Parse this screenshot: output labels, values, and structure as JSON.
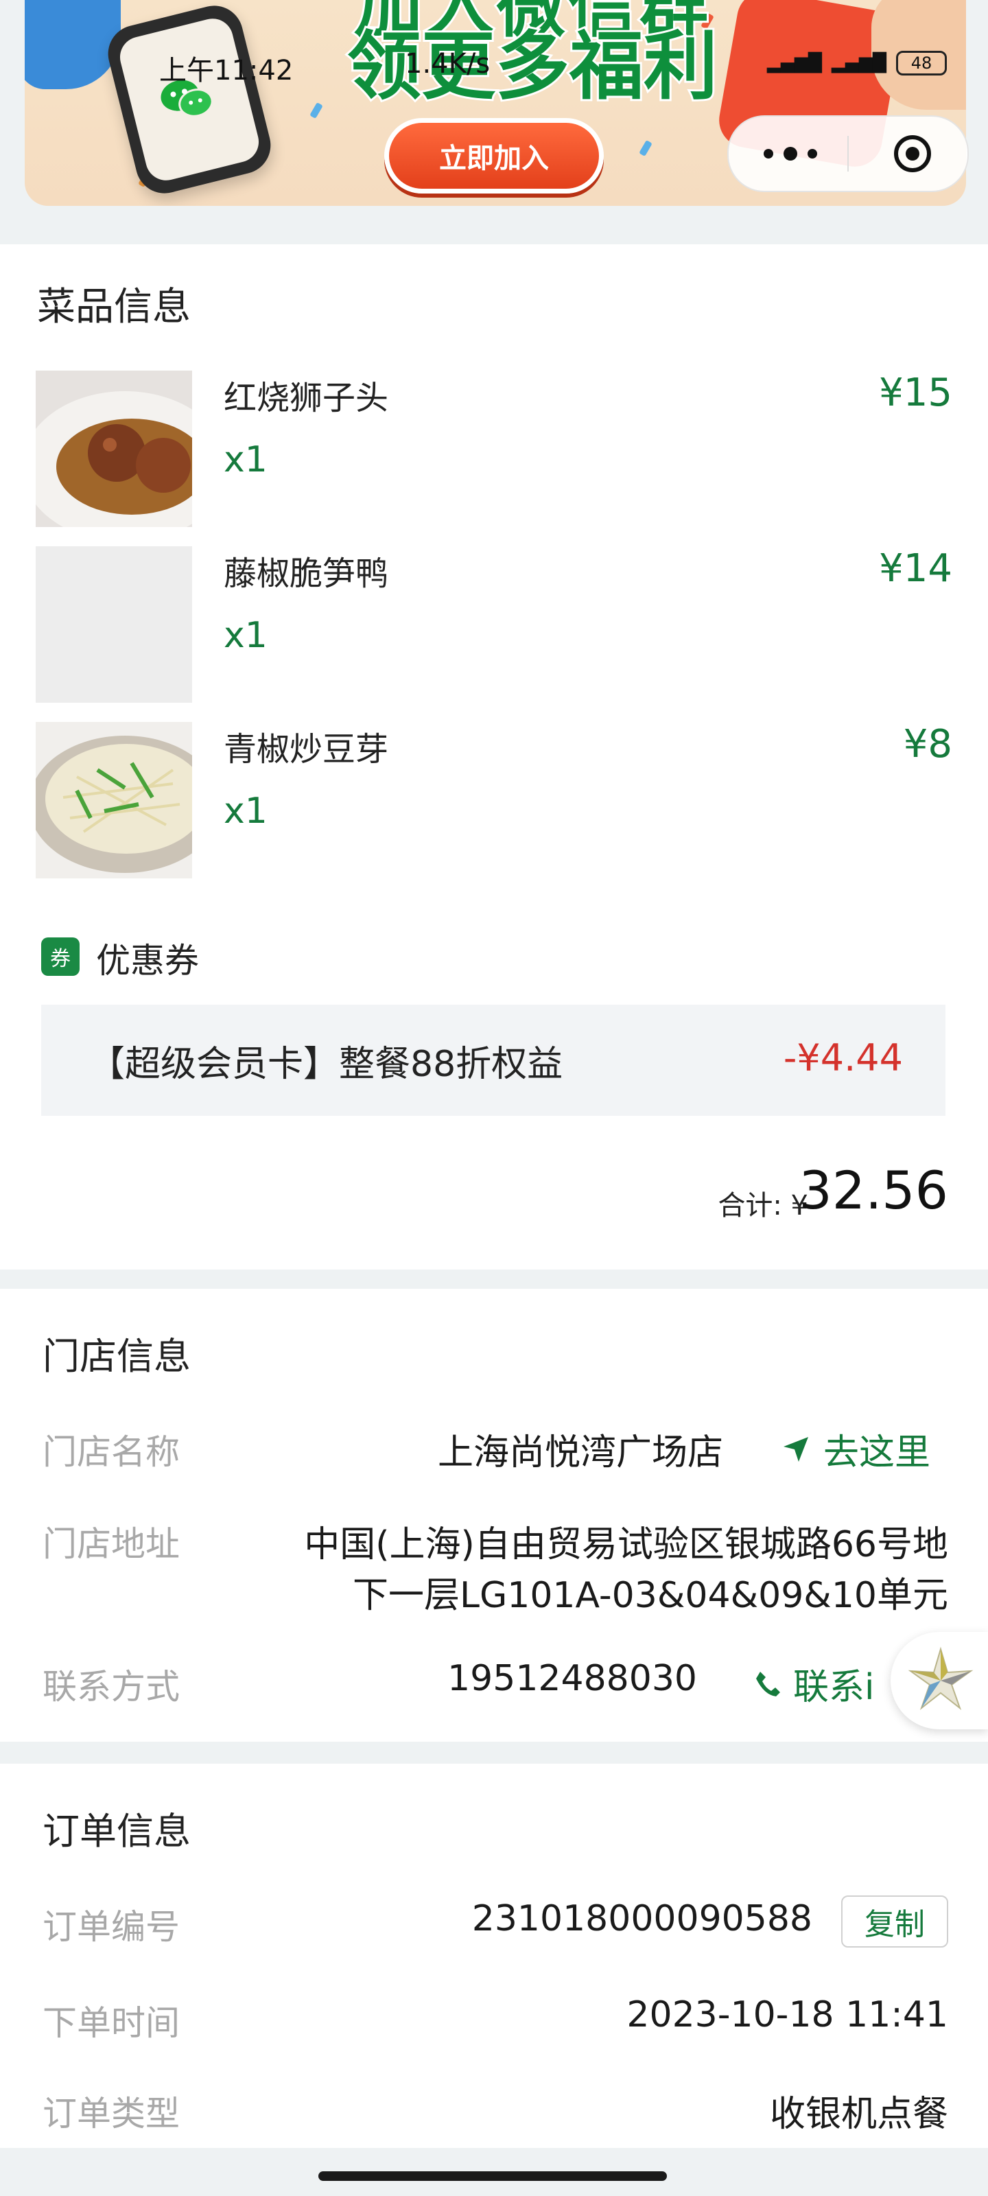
{
  "status_bar": {
    "time": "上午11:42",
    "network_speed": "1.4K/s",
    "battery": "48"
  },
  "banner": {
    "title_line1": "加入微信群",
    "title_line2": "领更多福利",
    "join_button": "立即加入"
  },
  "dishes": {
    "title": "菜品信息",
    "items": [
      {
        "name": "红烧狮子头",
        "qty": "x1",
        "price": "¥15"
      },
      {
        "name": "藤椒脆笋鸭",
        "qty": "x1",
        "price": "¥14"
      },
      {
        "name": "青椒炒豆芽",
        "qty": "x1",
        "price": "¥8"
      }
    ],
    "coupon_badge": "券",
    "coupon_label": "优惠券",
    "coupon_desc": "【超级会员卡】整餐88折权益",
    "coupon_discount": "-¥4.44",
    "total_label": "合计: ¥",
    "total_value": "32.56"
  },
  "store": {
    "title": "门店信息",
    "name_label": "门店名称",
    "name": "上海尚悦湾广场店",
    "navigate": "去这里",
    "address_label": "门店地址",
    "address_line1": "中国(上海)自由贸易试验区银城路66号地",
    "address_line2": "下一层LG101A-03&04&09&10单元",
    "phone_label": "联系方式",
    "phone": "19512488030",
    "contact": "联系i"
  },
  "order": {
    "title": "订单信息",
    "number_label": "订单编号",
    "number": "231018000090588",
    "copy": "复制",
    "time_label": "下单时间",
    "time": "2023-10-18 11:41",
    "type_label": "订单类型",
    "type": "收银机点餐"
  },
  "colors": {
    "green": "#157a3c",
    "red": "#d4322c",
    "grey_label": "#a8a8a8",
    "page_bg": "#eef2f3"
  },
  "icons": [
    "wechat-icon",
    "more-icon",
    "target-icon",
    "coupon-icon",
    "navigate-arrow-icon",
    "phone-icon",
    "float-star-icon"
  ]
}
